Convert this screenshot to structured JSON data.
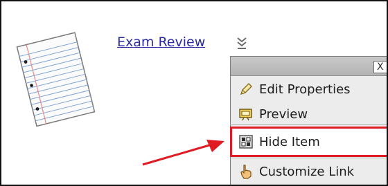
{
  "content_item": {
    "title": "Exam Review",
    "icon": "notebook-paper-icon",
    "menu_icon": "chevron-double-down-icon"
  },
  "context_menu": {
    "close_label": "X",
    "items": [
      {
        "label": "Edit Properties",
        "icon": "pencil-icon"
      },
      {
        "label": "Preview",
        "icon": "preview-window-icon"
      },
      {
        "label": "Hide Item",
        "icon": "hide-item-icon",
        "highlighted": true
      },
      {
        "label": "Customize Link",
        "icon": "hand-pointer-icon"
      }
    ]
  },
  "annotation": {
    "highlight_color": "#e01b24",
    "arrow_color": "#e01b24"
  }
}
